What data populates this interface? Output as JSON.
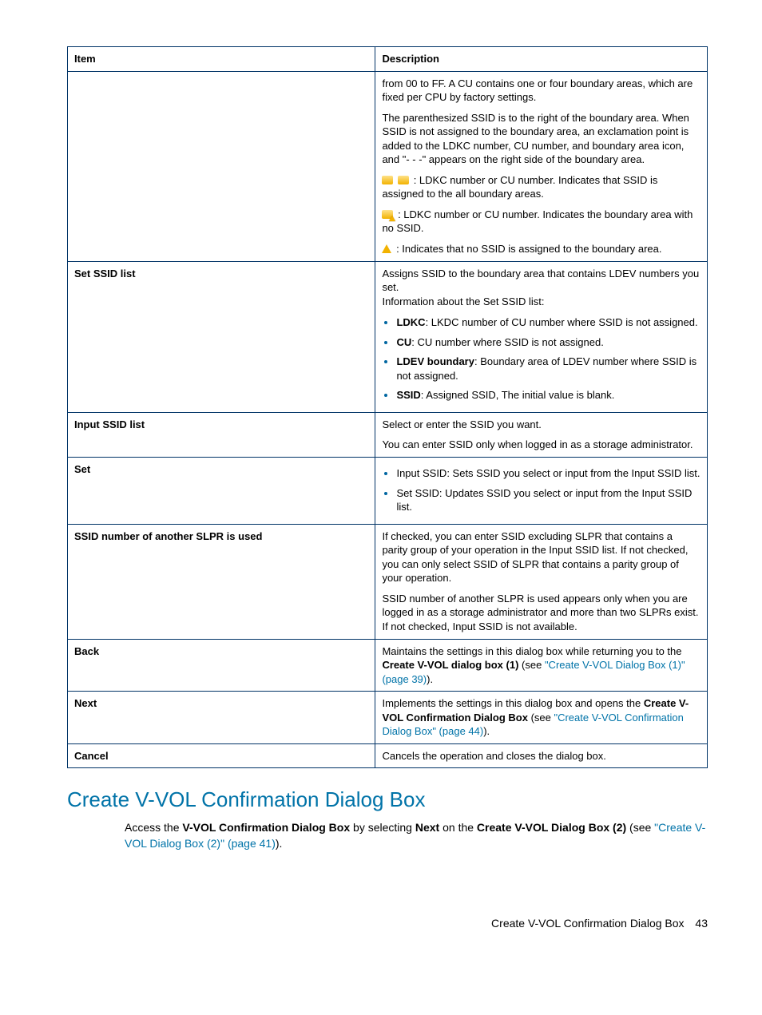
{
  "table": {
    "headers": {
      "item": "Item",
      "description": "Description"
    },
    "rows": {
      "row1": {
        "item": "",
        "desc_p1": "from 00 to FF. A CU contains one or four boundary areas, which are fixed per CPU by factory settings.",
        "desc_p2": "The parenthesized SSID is to the right of the boundary area. When SSID is not assigned to the boundary area, an exclamation point is added to the LDKC number, CU number, and boundary area icon, and \"- - -\" appears on the right side of the boundary area.",
        "desc_p3": ": LDKC number or CU number. Indicates that SSID is assigned to the all boundary areas.",
        "desc_p4": ": LDKC number or CU number. Indicates the boundary area with no SSID.",
        "desc_p5": ": Indicates that no SSID is assigned to the boundary area."
      },
      "row2": {
        "item": "Set SSID list",
        "desc_p1": "Assigns SSID to the boundary area that contains LDEV numbers you set.",
        "desc_p2": "Information about the Set SSID list:",
        "li1_label": "LDKC",
        "li1_text": ": LKDC number of CU number where SSID is not assigned.",
        "li2_label": "CU",
        "li2_text": ": CU number where SSID is not assigned.",
        "li3_label": "LDEV boundary",
        "li3_text": ": Boundary area of LDEV number where SSID is not assigned.",
        "li4_label": "SSID",
        "li4_text": ": Assigned SSID, The initial value is blank."
      },
      "row3": {
        "item": "Input SSID list",
        "desc_p1": "Select or enter the SSID you want.",
        "desc_p2": "You can enter SSID only when logged in as a storage administrator."
      },
      "row4": {
        "item": "Set",
        "li1": "Input SSID: Sets SSID you select or input from the Input SSID list.",
        "li2": "Set SSID: Updates SSID you select or input from the Input SSID list."
      },
      "row5": {
        "item": "SSID number of another SLPR is used",
        "desc_p1": "If checked, you can enter SSID excluding SLPR that contains a parity group of your operation in the Input SSID list. If not checked, you can only select SSID of SLPR that contains a parity group of your operation.",
        "desc_p2": "SSID number of another SLPR is used appears only when you are logged in as a storage administrator and more than two SLPRs exist. If not checked, Input SSID is not available."
      },
      "row6": {
        "item": "Back",
        "desc_pre": "Maintains the settings in this dialog box while returning you to the ",
        "desc_bold": "Create V-VOL dialog box (1)",
        "desc_mid": " (see ",
        "desc_link": "\"Create V-VOL Dialog Box (1)\" (page 39)",
        "desc_post": ")."
      },
      "row7": {
        "item": "Next",
        "desc_pre": "Implements the settings in this dialog box and opens the ",
        "desc_bold": "Create V-VOL Confirmation Dialog Box",
        "desc_mid": " (see ",
        "desc_link": "\"Create V-VOL Confirmation Dialog Box\" (page 44)",
        "desc_post": ")."
      },
      "row8": {
        "item": "Cancel",
        "desc": "Cancels the operation and closes the dialog box."
      }
    }
  },
  "section": {
    "heading": "Create V-VOL Confirmation Dialog Box",
    "para_pre": "Access the ",
    "para_bold1": "V-VOL Confirmation Dialog Box",
    "para_mid1": " by selecting ",
    "para_bold2": "Next",
    "para_mid2": " on the ",
    "para_bold3": "Create V-VOL Dialog Box (2)",
    "para_mid3": " (see ",
    "para_link": "\"Create V-VOL Dialog Box (2)\" (page 41)",
    "para_post": ")."
  },
  "footer": {
    "text": "Create V-VOL Confirmation Dialog Box",
    "page": "43"
  }
}
